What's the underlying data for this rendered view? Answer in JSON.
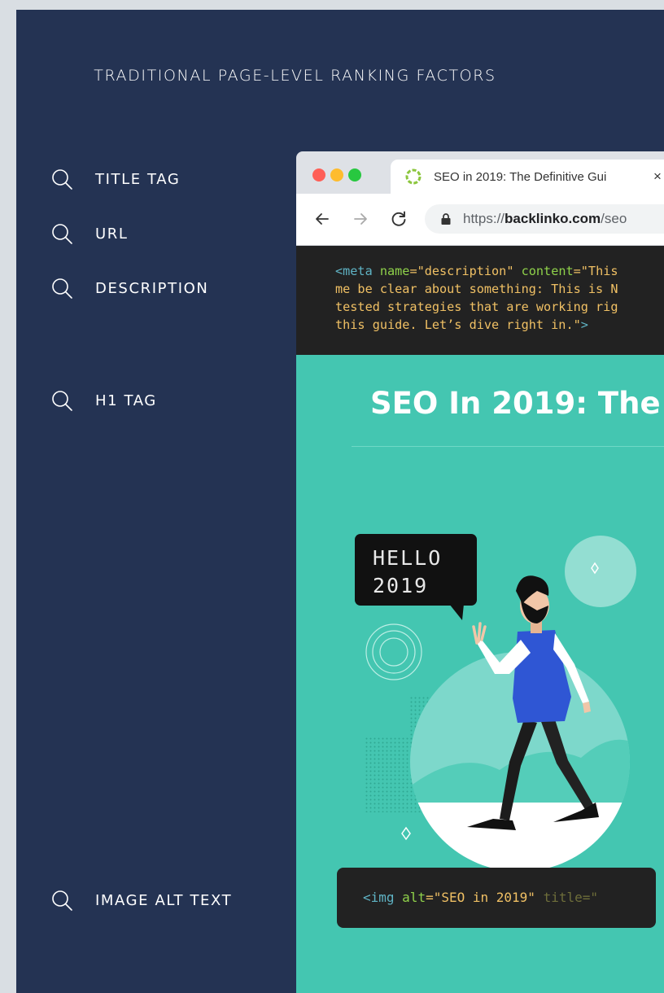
{
  "heading": "TRADITIONAL PAGE-LEVEL RANKING FACTORS",
  "factors": [
    {
      "label": "TITLE TAG",
      "icon": "search-icon"
    },
    {
      "label": "URL",
      "icon": "search-icon"
    },
    {
      "label": "DESCRIPTION",
      "icon": "search-icon"
    },
    {
      "label": "H1 TAG",
      "icon": "search-icon"
    },
    {
      "label": "IMAGE ALT TEXT",
      "icon": "search-icon"
    }
  ],
  "browser": {
    "tab_title": "SEO in 2019: The Definitive Gui",
    "tab_close": "×",
    "url_scheme": "https://",
    "url_domain": "backlinko.com",
    "url_path": "/seo",
    "meta_code": {
      "tag_open": "<meta",
      "attr_name": "name",
      "name_value": "=\"description\"",
      "attr_content": "content",
      "content_value": "=\"This",
      "line2": "me be clear about something: This is N",
      "line3": "tested strategies that are working rig",
      "line4_text": "this guide. Let’s dive right in.\"",
      "tag_close": ">"
    },
    "h1": "SEO In 2019: The",
    "speech_bubble": {
      "line1": "HELLO",
      "line2": "2019"
    },
    "img_code": {
      "tag_open": "<img",
      "attr_alt": "alt",
      "alt_value": "=\"SEO in 2019\"",
      "attr_title": "title",
      "title_value": "=\""
    }
  },
  "colors": {
    "panel": "#243353",
    "content": "#44c6b1",
    "code_bg": "#222222"
  }
}
